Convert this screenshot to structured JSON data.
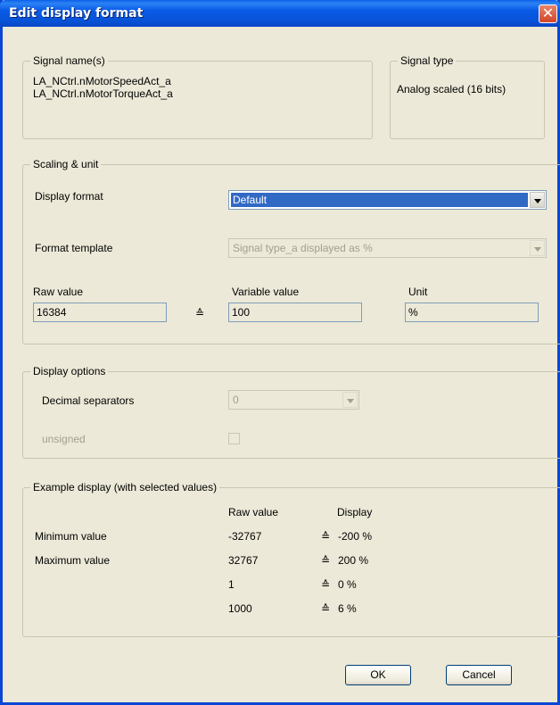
{
  "window": {
    "title": "Edit display format",
    "close_glyph": "✕"
  },
  "signal_names": {
    "legend": "Signal name(s)",
    "lines": [
      "LA_NCtrl.nMotorSpeedAct_a",
      "LA_NCtrl.nMotorTorqueAct_a"
    ]
  },
  "signal_type": {
    "legend": "Signal type",
    "value": "Analog scaled (16 bits)"
  },
  "scaling": {
    "legend": "Scaling & unit",
    "display_format_label": "Display format",
    "display_format_value": "Default",
    "format_template_label": "Format template",
    "format_template_value": "Signal type_a displayed as %",
    "raw_value_label": "Raw value",
    "raw_value": "16384",
    "equals_glyph": "≙",
    "variable_value_label": "Variable value",
    "variable_value": "100",
    "unit_label": "Unit",
    "unit_value": "%"
  },
  "display_options": {
    "legend": "Display options",
    "decimal_separators_label": "Decimal separators",
    "decimal_separators_value": "0",
    "unsigned_label": "unsigned",
    "unsigned_checked": false
  },
  "example": {
    "legend": "Example display (with selected values)",
    "col_raw": "Raw value",
    "col_display": "Display",
    "rows": [
      {
        "label": "Minimum value",
        "raw": "-32767",
        "display": "-200 %"
      },
      {
        "label": "Maximum value",
        "raw": "32767",
        "display": "200 %"
      },
      {
        "label": "",
        "raw": "1",
        "display": "0 %"
      },
      {
        "label": "",
        "raw": "1000",
        "display": "6 %"
      }
    ]
  },
  "buttons": {
    "ok": "OK",
    "cancel": "Cancel"
  },
  "colors": {
    "title_bar": "#0a5ae6",
    "dialog_bg": "#ece9d8",
    "selection": "#316ac5",
    "close_button": "#d2452a"
  }
}
